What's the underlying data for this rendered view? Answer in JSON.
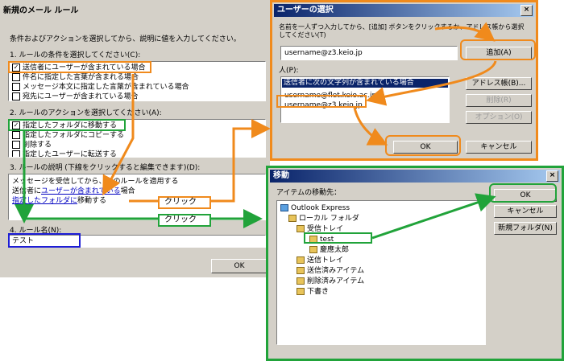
{
  "rule_dialog": {
    "title": "新規のメール ルール",
    "instruction": "条件およびアクションを選択してから、説明に値を入力してください。",
    "section1_label": "1. ルールの条件を選択してください(C):",
    "conditions": [
      {
        "label": "送信者にユーザーが含まれている場合",
        "checked": true
      },
      {
        "label": "件名に指定した言葉が含まれる場合",
        "checked": false
      },
      {
        "label": "メッセージ本文に指定した言葉が含まれている場合",
        "checked": false
      },
      {
        "label": "宛先にユーザーが含まれている場合",
        "checked": false
      }
    ],
    "section2_label": "2. ルールのアクションを選択してください(A):",
    "actions": [
      {
        "label": "指定したフォルダに移動する",
        "checked": true
      },
      {
        "label": "指定したフォルダにコピーする",
        "checked": false
      },
      {
        "label": "削除する",
        "checked": false
      },
      {
        "label": "指定したユーザーに転送する",
        "checked": false
      }
    ],
    "section3_label": "3. ルールの説明 (下線をクリックすると編集できます)(D):",
    "desc_line1": "メッセージを受信してから、このルールを適用する",
    "desc_line2_prefix": "送信者に",
    "desc_line2_link": "ユーザーが含まれている",
    "desc_line2_suffix": "場合",
    "desc_line3_link": "指定したフォルダに",
    "desc_line3_suffix": "移動する",
    "section4_label": "4. ルール名(N):",
    "rule_name_value": "テスト",
    "ok_label": "OK"
  },
  "annotations": {
    "click_label_1": "クリック",
    "click_label_2": "クリック"
  },
  "user_dialog": {
    "title": "ユーザーの選択",
    "close_glyph": "×",
    "instruction": "名前を一人ずつ入力してから、[追加] ボタンをクリックするか、アドレス帳から選択してください(T)",
    "input_value": "username@z3.keio.jp",
    "add_label": "追加(A)",
    "people_label": "人(P):",
    "people": [
      {
        "label": "送信者に次の文字列が含まれている場合",
        "selected": true
      },
      {
        "label": "username@flet.keio.ac.jp",
        "selected": false
      },
      {
        "label": "username@z3.keio.jp",
        "selected": false
      }
    ],
    "address_book_label": "アドレス帳(B)...",
    "delete_label": "削除(R)",
    "options_label": "オプション(O)",
    "ok_label": "OK",
    "cancel_label": "キャンセル"
  },
  "move_dialog": {
    "title": "移動",
    "close_glyph": "×",
    "move_to_label": "アイテムの移動先：",
    "tree": [
      {
        "label": "Outlook Express",
        "level": 0,
        "icon": "outlook-icon"
      },
      {
        "label": "ローカル フォルダ",
        "level": 1,
        "icon": "local-folder-icon"
      },
      {
        "label": "受信トレイ",
        "level": 2,
        "icon": "inbox-icon"
      },
      {
        "label": "test",
        "level": 3,
        "icon": "folder-icon"
      },
      {
        "label": "慶應太郎",
        "level": 3,
        "icon": "folder-icon"
      },
      {
        "label": "送信トレイ",
        "level": 2,
        "icon": "outbox-icon"
      },
      {
        "label": "送信済みアイテム",
        "level": 2,
        "icon": "sent-icon"
      },
      {
        "label": "削除済みアイテム",
        "level": 2,
        "icon": "trash-icon"
      },
      {
        "label": "下書き",
        "level": 2,
        "icon": "draft-icon"
      }
    ],
    "ok_label": "OK",
    "cancel_label": "キャンセル",
    "new_folder_label": "新規フォルダ(N)"
  },
  "colors": {
    "orange": "#f08a1c",
    "green": "#21a33a",
    "blue": "#1d1dd6",
    "title_bar": "#0a246a"
  }
}
